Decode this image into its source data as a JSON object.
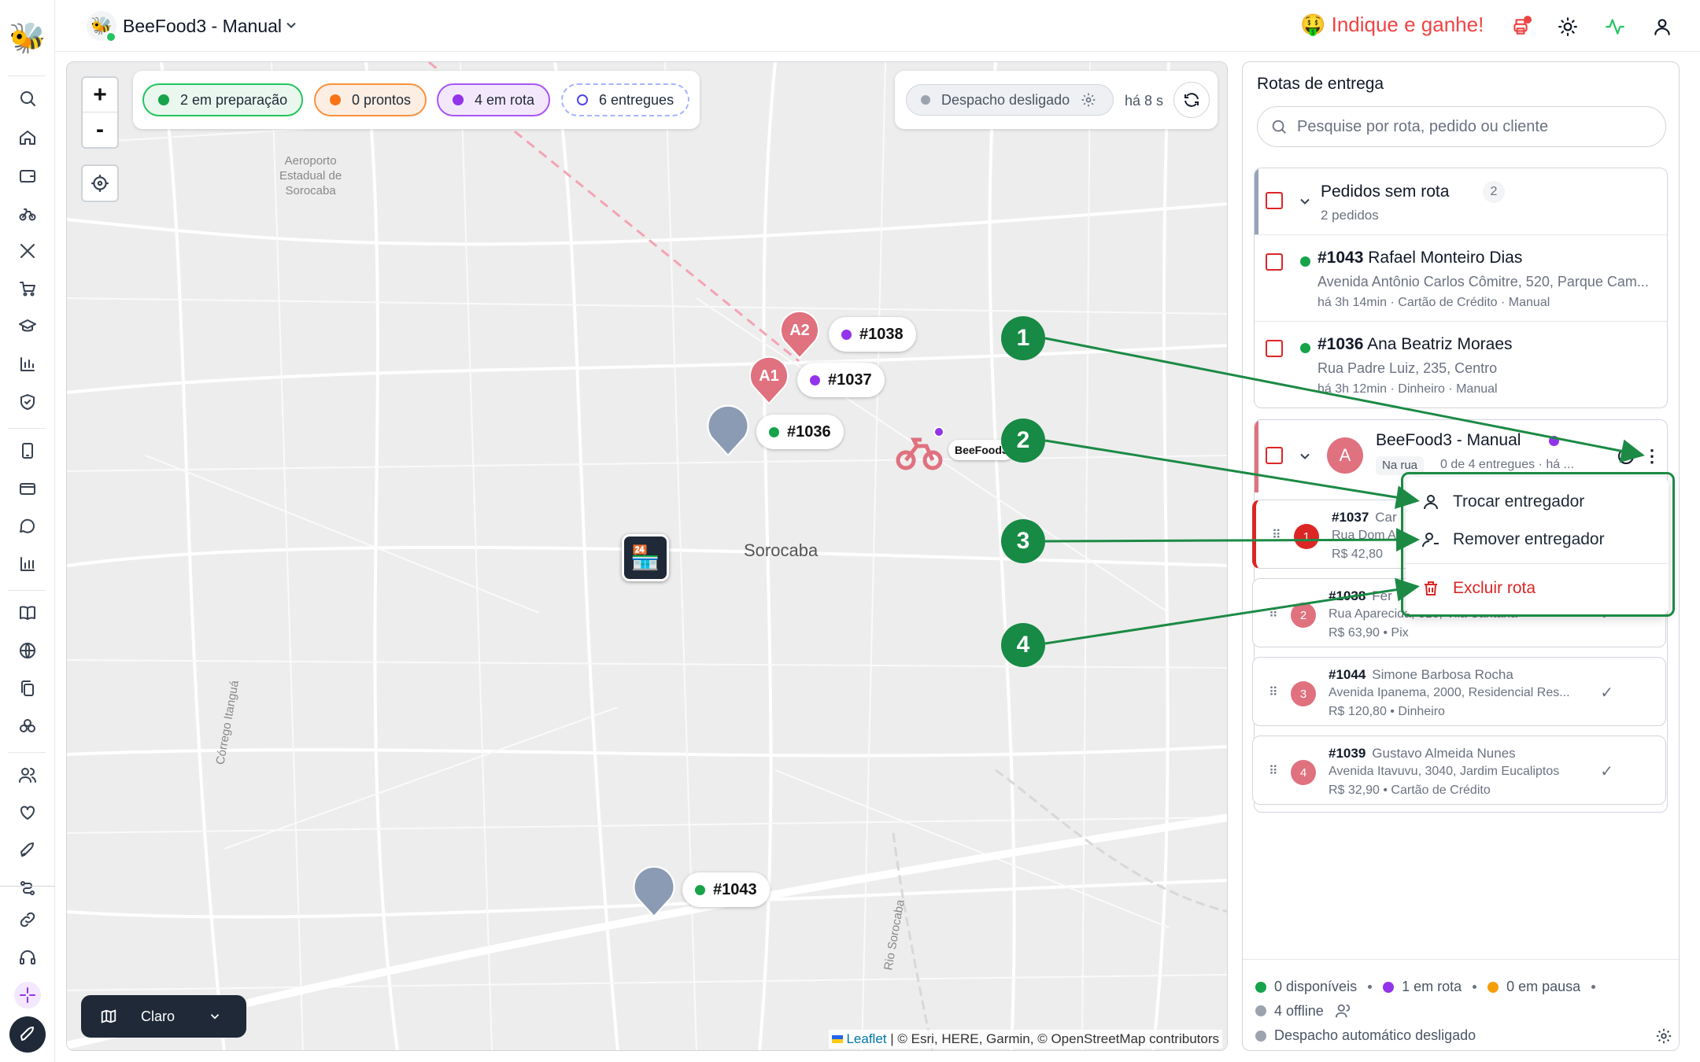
{
  "topbar": {
    "store_name": "BeeFood3 - Manual",
    "refer_label": "🤑 Indique e ganhe!"
  },
  "sidebar": {
    "items": [
      "search-icon",
      "home-icon",
      "wallet-icon",
      "bike-icon",
      "utensils-icon",
      "cart-icon",
      "school-icon",
      "chart-icon",
      "shield-icon",
      "phone-icon",
      "card-icon",
      "chat-icon",
      "bar-chart-icon",
      "book-icon",
      "globe-icon",
      "copy-icon",
      "flower-icon",
      "users-icon",
      "heart-icon",
      "rocket-icon",
      "route-icon",
      "link-icon",
      "headset-icon",
      "sparkle-icon",
      "launch-icon"
    ]
  },
  "map": {
    "filters": [
      {
        "label": "2 em preparação",
        "color": "#16a34a",
        "bg": "#e9f7ee",
        "border": "#22c55e"
      },
      {
        "label": "0 prontos",
        "color": "#f97316",
        "bg": "#fdeee4",
        "border": "#fb923c"
      },
      {
        "label": "4 em rota",
        "color": "#9333ea",
        "bg": "#f3e8fb",
        "border": "#a855f7"
      },
      {
        "label": "6 entregues",
        "color": "#ffffff",
        "bg": "#ffffff",
        "border": "#a5b4fc"
      }
    ],
    "dispatch_label": "Despacho desligado",
    "dispatch_ago": "há 8 s",
    "zoom_in": "+",
    "zoom_out": "-",
    "airport_label": "Aeroporto\nEstadual de\nSorocaba",
    "city_label": "Sorocaba",
    "creek_label": "Córrego Itanguá",
    "river_label": "Rio Sorocaba",
    "map_style_label": "Claro",
    "attribution_link": "Leaflet",
    "attribution_text": " | © Esri, HERE, Garmin, © OpenStreetMap contributors",
    "markers": {
      "a2": "A2",
      "a1": "A1",
      "t1038": "#1038",
      "t1037": "#1037",
      "t1036": "#1036",
      "t1043": "#1043",
      "courier_label": "BeeFood3"
    },
    "annotations": [
      "1",
      "2",
      "3",
      "4"
    ]
  },
  "panel": {
    "title": "Rotas de entrega",
    "search_placeholder": "Pesquise por rota, pedido ou cliente",
    "unrouted": {
      "title": "Pedidos sem rota",
      "count": "2",
      "sub": "2 pedidos",
      "orders": [
        {
          "id": "#1043",
          "name": "Rafael Monteiro Dias",
          "address": "Avenida Antônio Carlos Cômitre, 520, Parque Cam...",
          "meta": "há 3h 14min · Cartão de Crédito · Manual"
        },
        {
          "id": "#1036",
          "name": "Ana Beatriz Moraes",
          "address": "Rua Padre Luiz, 235, Centro",
          "meta": "há 3h 12min · Dinheiro · Manual"
        }
      ]
    },
    "route": {
      "avatar": "A",
      "name": "BeeFood3 - Manual",
      "status": "Na rua",
      "progress": "0 de 4 entregues · há ...",
      "stops": [
        {
          "n": "1",
          "id": "#1037",
          "name": "Car",
          "address": "Rua Dom A",
          "price": "R$ 42,80"
        },
        {
          "n": "2",
          "id": "#1038",
          "name": "Fer",
          "address": "Rua Aparecida, 318, Vila Santana",
          "price": "R$ 63,90 • Pix"
        },
        {
          "n": "3",
          "id": "#1044",
          "name": "Simone Barbosa Rocha",
          "address": "Avenida Ipanema, 2000, Residencial Res...",
          "price": "R$ 120,80 • Dinheiro"
        },
        {
          "n": "4",
          "id": "#1039",
          "name": "Gustavo Almeida Nunes",
          "address": "Avenida Itavuvu, 3040, Jardim Eucaliptos",
          "price": "R$ 32,90 • Cartão de Crédito"
        }
      ]
    },
    "menu": {
      "swap": "Trocar entregador",
      "remove": "Remover entregador",
      "delete": "Excluir rota"
    },
    "footer": {
      "available": "0 disponíveis",
      "on_route": "1 em rota",
      "paused": "0 em pausa",
      "offline": "4 offline",
      "auto_dispatch": "Despacho automático desligado"
    }
  },
  "colors": {
    "accent_green": "#178a45",
    "alert_red": "#dc2626",
    "route_pink": "#e0717f"
  }
}
